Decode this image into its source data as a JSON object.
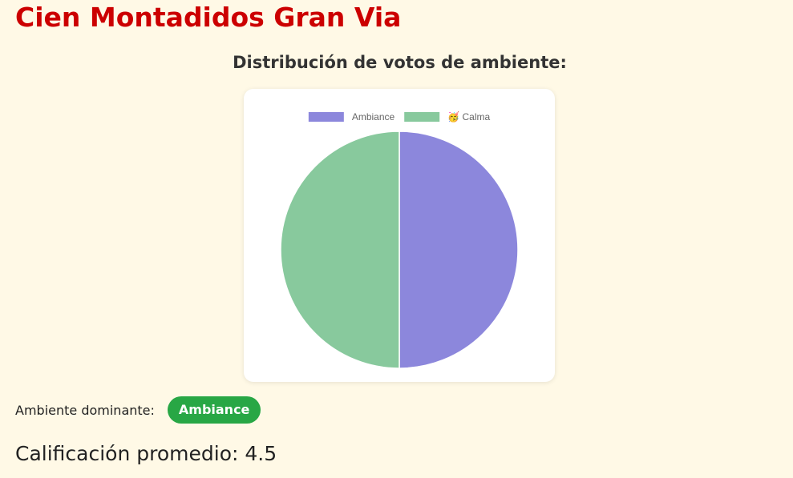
{
  "restaurant": {
    "name": "Cien Montadidos Gran Via"
  },
  "chart_heading": "Distribución de votos de ambiente:",
  "chart_data": {
    "type": "pie",
    "title": "",
    "labels": [
      "Ambiance",
      "🥳 Calma"
    ],
    "values": [
      1,
      1
    ],
    "colors": [
      "#8c87dc",
      "#88c99d"
    ],
    "legend_position": "top"
  },
  "dominant": {
    "label": "Ambiente dominante:",
    "value": "Ambiance",
    "badge_color": "#28a745"
  },
  "rating": {
    "label": "Calificación promedio:",
    "value": "4.5"
  }
}
